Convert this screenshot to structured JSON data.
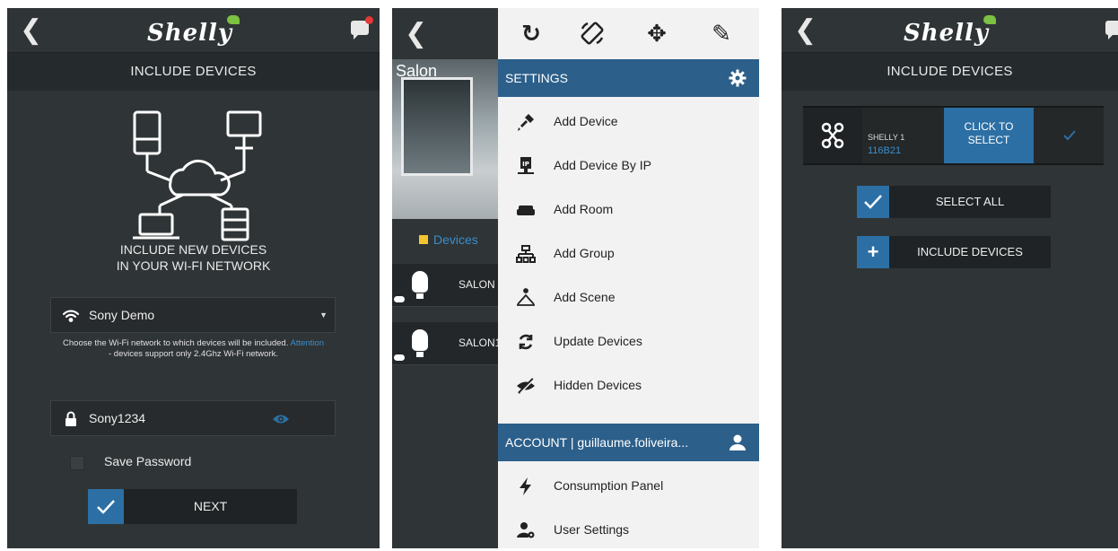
{
  "panel1": {
    "logo": "Shelly",
    "subtitle": "INCLUDE DEVICES",
    "include_line1": "INCLUDE NEW DEVICES",
    "include_line2": "IN YOUR WI-FI NETWORK",
    "wifi_value": "Sony Demo",
    "hint_part1": "Choose the Wi-Fi network to which devices will be included.",
    "hint_attention": "Attention",
    "hint_part2": "- devices support only 2.4Ghz Wi-Fi network.",
    "password_value": "Sony1234",
    "save_password_label": "Save Password",
    "next_label": "NEXT"
  },
  "panel2": {
    "room_title": "Salon",
    "devices_tab": "Devices",
    "device_rows": [
      "SALON",
      "SALON1"
    ],
    "settings_header": "SETTINGS",
    "menu_items": [
      {
        "label": "Add Device",
        "icon": "plug-icon"
      },
      {
        "label": "Add Device By IP",
        "icon": "ip-monitor-icon"
      },
      {
        "label": "Add Room",
        "icon": "sofa-icon"
      },
      {
        "label": "Add Group",
        "icon": "group-hierarchy-icon"
      },
      {
        "label": "Add Scene",
        "icon": "scene-icon"
      },
      {
        "label": "Update Devices",
        "icon": "refresh-icon"
      },
      {
        "label": "Hidden Devices",
        "icon": "hidden-eye-icon"
      }
    ],
    "account_header": "ACCOUNT | guillaume.foliveira...",
    "account_items": [
      {
        "label": "Consumption Panel",
        "icon": "lightning-icon"
      },
      {
        "label": "User Settings",
        "icon": "user-gear-icon"
      }
    ]
  },
  "panel3": {
    "logo": "Shelly",
    "subtitle": "INCLUDE DEVICES",
    "device_name": "SHELLY 1",
    "device_id": "116B21",
    "click_to_select_line1": "CLICK TO",
    "click_to_select_line2": "SELECT",
    "select_all_label": "SELECT ALL",
    "include_devices_label": "INCLUDE DEVICES"
  },
  "colors": {
    "background": "#2f3436",
    "accent_blue": "#2c6fa4",
    "link_blue": "#3a8ecc",
    "drawer_bg": "#f2f2f2",
    "notification_red": "#e53935",
    "brand_green": "#7cc142"
  }
}
